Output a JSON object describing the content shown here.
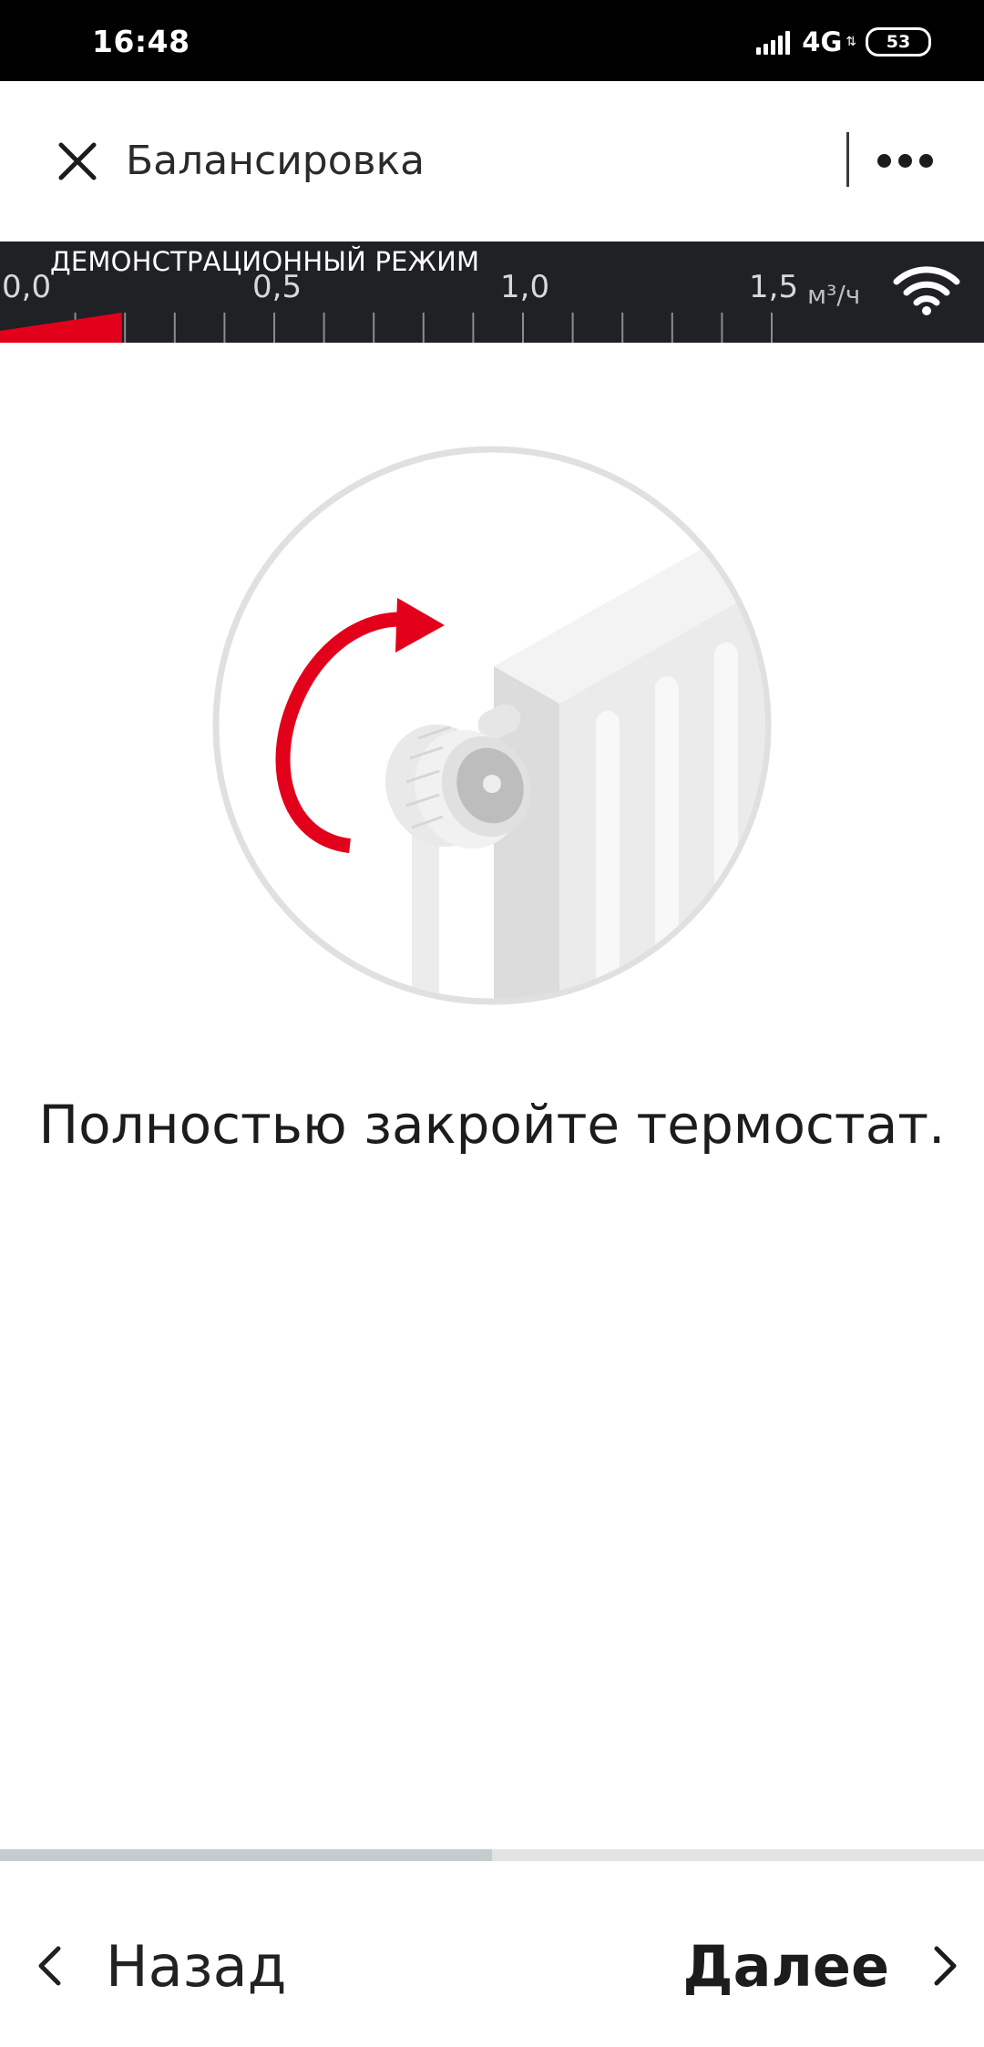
{
  "status_bar": {
    "time": "16:48",
    "network": "4G",
    "battery": "53"
  },
  "app_bar": {
    "title": "Балансировка",
    "close_icon": "close-icon",
    "menu_icon": "more-icon"
  },
  "flow_scale": {
    "mode_label": "ДЕМОНСТРАЦИОННЫЙ РЕЖИМ",
    "ticks": [
      "0,0",
      "0,5",
      "1,0",
      "1,5"
    ],
    "unit": "м³/ч",
    "current_value": 0.25,
    "max_value": 2.0,
    "accent_color": "#e3001b",
    "wifi_icon": "wifi-icon"
  },
  "illustration": {
    "icon": "radiator-thermostat-icon",
    "arrow_color": "#e3001b"
  },
  "instruction": "Полностью закройте термостат.",
  "progress": {
    "fraction": 0.5
  },
  "nav": {
    "back_label": "Назад",
    "next_label": "Далее"
  }
}
